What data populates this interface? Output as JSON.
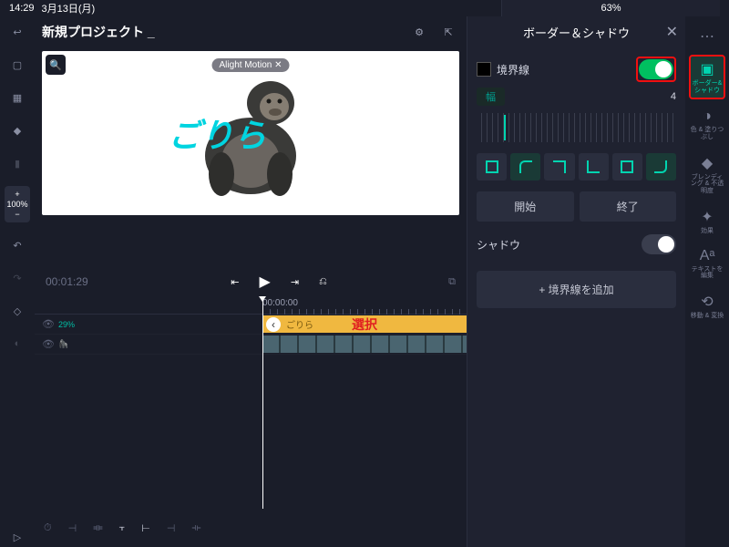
{
  "status": {
    "time": "14:29",
    "date": "3月13日(月)",
    "battery": "63%"
  },
  "header": {
    "title": "新規プロジェクト _"
  },
  "preview": {
    "watermark": "Alight Motion ✕",
    "overlay_text": "ごりら"
  },
  "transport": {
    "current": "00:01:29",
    "ruler_zero": "00:00:00"
  },
  "leftrail": {
    "zoom_plus": "+",
    "zoom_val": "100%",
    "zoom_minus": "−",
    "fps_label": "29%"
  },
  "tracks": {
    "text_clip_label": "ごりら",
    "selection_label": "選択"
  },
  "panel": {
    "title": "ボーダー＆シャドウ",
    "border_label": "境界線",
    "width_label": "幅",
    "width_value": "4",
    "start": "開始",
    "end": "終了",
    "shadow_label": "シャドウ",
    "add_border": "+ 境界線を追加"
  },
  "farrail": {
    "items": [
      {
        "icon": "⋯",
        "label": ""
      },
      {
        "icon": "▣",
        "label": "ボーダー&\nシャドウ"
      },
      {
        "icon": "◑",
        "label": "色 & 塗りつぶし"
      },
      {
        "icon": "◆",
        "label": "ブレンディング\n& 不透明度"
      },
      {
        "icon": "✦",
        "label": "効果"
      },
      {
        "icon": "Aᵃ",
        "label": "テキストを編集"
      },
      {
        "icon": "⟲",
        "label": "移動 & 変換"
      }
    ]
  }
}
